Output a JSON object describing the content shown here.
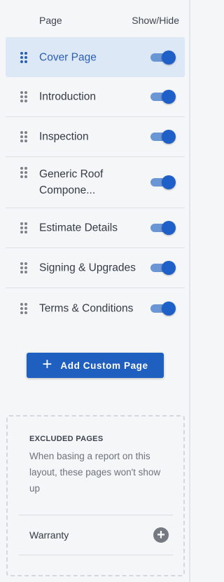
{
  "header": {
    "page_col": "Page",
    "show_hide_col": "Show/Hide"
  },
  "pages": [
    {
      "label": "Cover Page",
      "active": true,
      "shown": true
    },
    {
      "label": "Introduction",
      "active": false,
      "shown": true
    },
    {
      "label": "Inspection",
      "active": false,
      "shown": true
    },
    {
      "label": "Generic Roof Compone...",
      "active": false,
      "shown": true
    },
    {
      "label": "Estimate Details",
      "active": false,
      "shown": true
    },
    {
      "label": "Signing & Upgrades",
      "active": false,
      "shown": true
    },
    {
      "label": "Terms & Conditions",
      "active": false,
      "shown": true
    }
  ],
  "add_button": {
    "icon": "plus-icon",
    "label": "Add Custom Page"
  },
  "excluded": {
    "title": "EXCLUDED PAGES",
    "description": "When basing a report on this layout, these pages won't show up",
    "items": [
      {
        "label": "Warranty",
        "icon": "add-circle-icon"
      }
    ]
  },
  "colors": {
    "accent": "#1f5fc8",
    "active_bg": "#dde8f6",
    "toggle_track": "#6a96d6"
  }
}
